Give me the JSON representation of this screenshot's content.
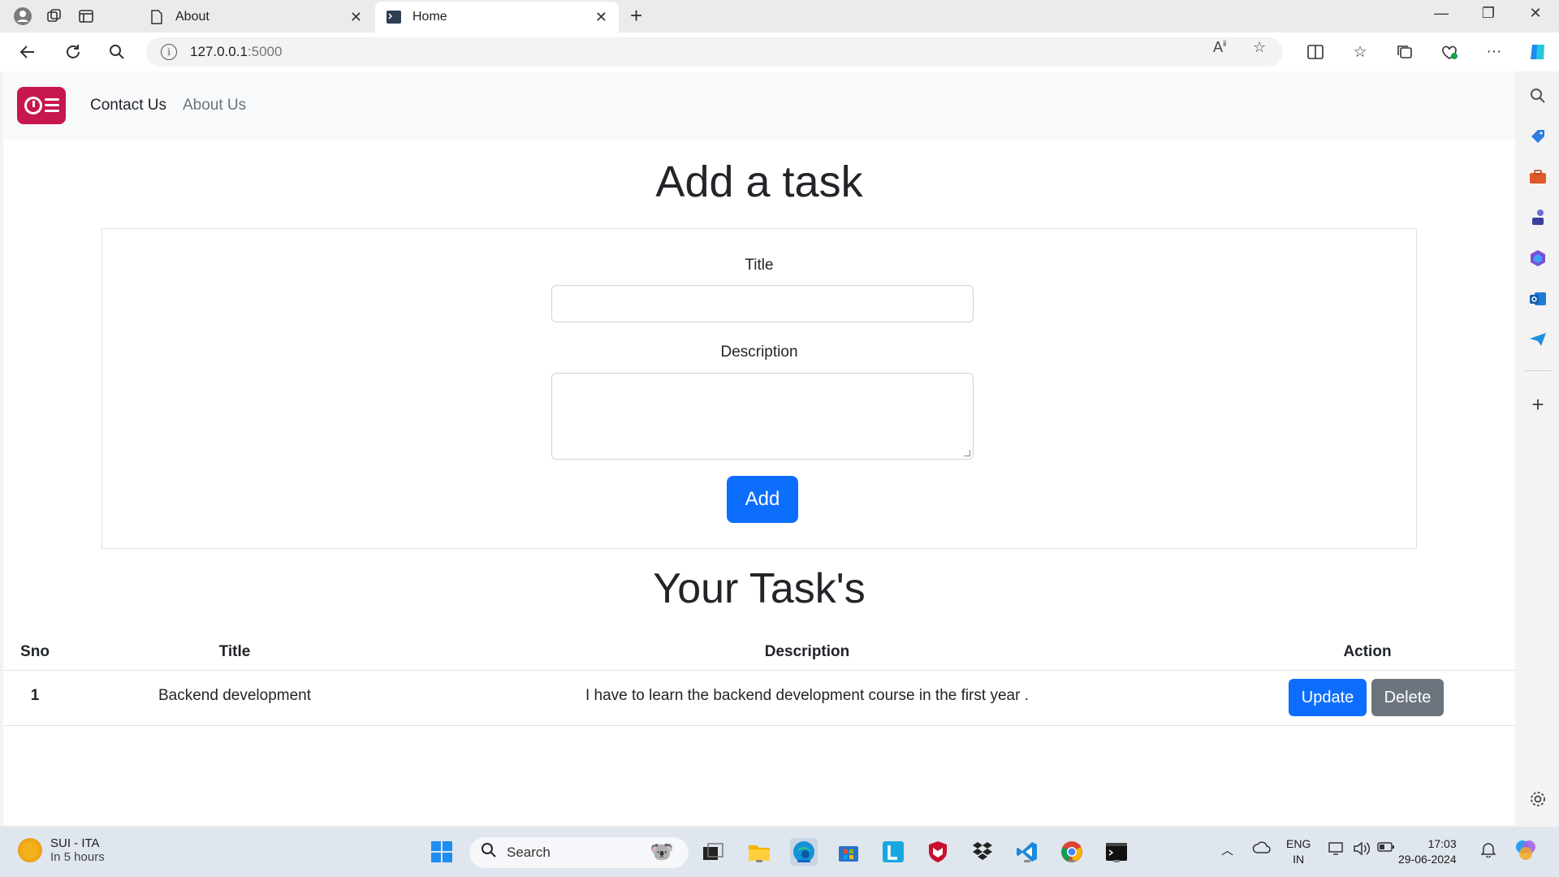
{
  "browser": {
    "tabs": [
      {
        "title": "About",
        "active": false
      },
      {
        "title": "Home",
        "active": true
      }
    ],
    "url_host": "127.0.0.1",
    "url_port": ":5000"
  },
  "navbar": {
    "links": [
      "Contact Us",
      "About Us"
    ],
    "logo_color": "#c8174f"
  },
  "form": {
    "heading": "Add a task",
    "title_label": "Title",
    "title_value": "",
    "description_label": "Description",
    "description_value": "",
    "submit_label": "Add"
  },
  "tasks": {
    "heading": "Your Task's",
    "columns": [
      "Sno",
      "Title",
      "Description",
      "Action"
    ],
    "rows": [
      {
        "sno": "1",
        "title": "Backend development",
        "description": "I have to learn the backend development course in the first year .",
        "update_label": "Update",
        "delete_label": "Delete"
      }
    ]
  },
  "taskbar": {
    "weather_title": "SUI - ITA",
    "weather_sub": "In 5 hours",
    "search_placeholder": "Search",
    "lang_line1": "ENG",
    "lang_line2": "IN",
    "time": "17:03",
    "date": "29-06-2024"
  },
  "colors": {
    "primary": "#0d6efd",
    "secondary": "#6c757d",
    "navbar_bg": "#f8f9fa"
  }
}
